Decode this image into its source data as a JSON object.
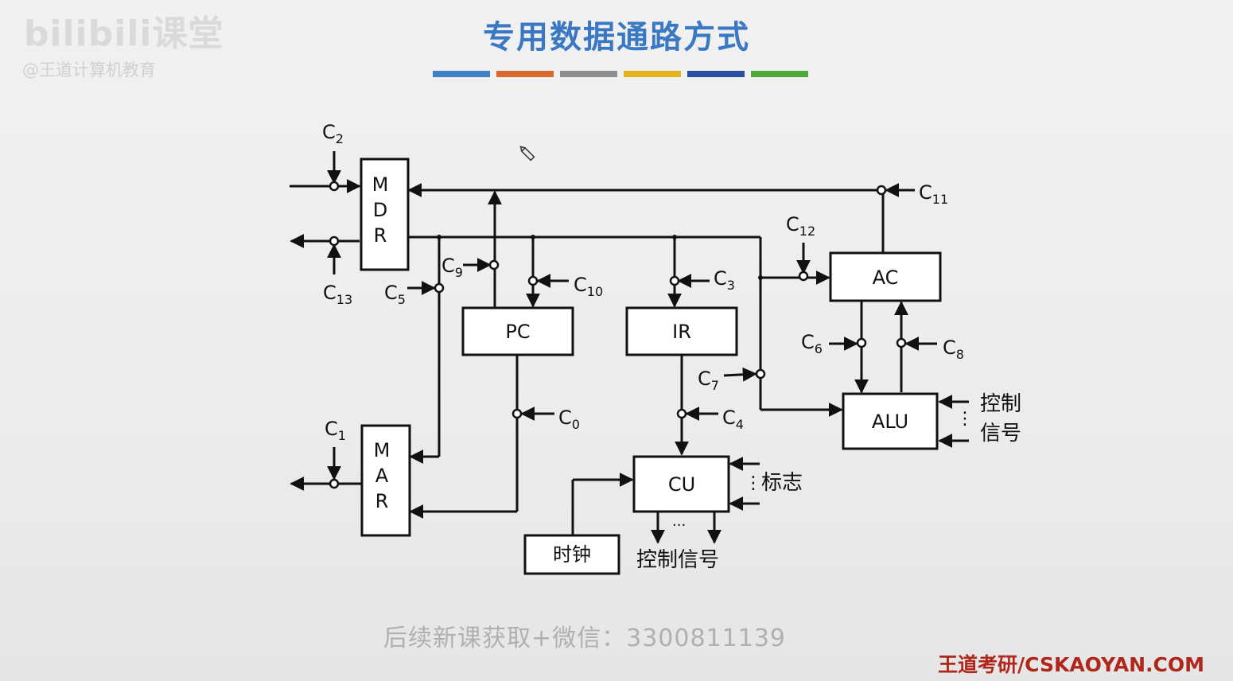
{
  "title": "专用数据通路方式",
  "stripe_colors": [
    "#3f7fc6",
    "#d96a2e",
    "#8f8f8f",
    "#e3b320",
    "#2d4fa1",
    "#4ea83a"
  ],
  "watermark": {
    "logo": "bilibili课堂",
    "handle": "@王道计算机教育"
  },
  "blocks": {
    "mdr": [
      "M",
      "D",
      "R"
    ],
    "mar": [
      "M",
      "A",
      "R"
    ],
    "pc": "PC",
    "ir": "IR",
    "ac": "AC",
    "alu": "ALU",
    "cu": "CU",
    "clock": "时钟"
  },
  "controls": {
    "c0": "0",
    "c1": "1",
    "c2": "2",
    "c3": "3",
    "c4": "4",
    "c5": "5",
    "c6": "6",
    "c7": "7",
    "c8": "8",
    "c9": "9",
    "c10": "10",
    "c11": "11",
    "c12": "12",
    "c13": "13"
  },
  "control_prefix": "C",
  "labels": {
    "alu_ctrl_1": "控制",
    "alu_ctrl_2": "信号",
    "flags": "标志",
    "cu_out": "控制信号",
    "ellipsis_h": "···",
    "ellipsis_v": "⋮"
  },
  "footer": {
    "promo": "后续新课获取+微信：3300811139",
    "brand": "王道考研/CSKAOYAN.COM"
  }
}
